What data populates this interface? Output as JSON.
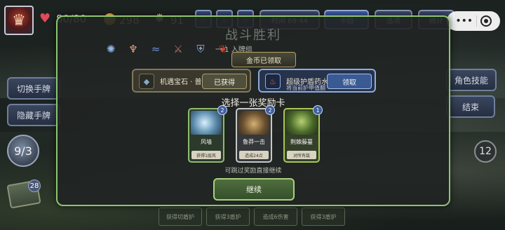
{
  "player": {
    "hp": "80/80",
    "gold": "298",
    "gems": "91"
  },
  "top_buttons": {
    "time": "时间 69:44",
    "deck": "卡组",
    "options": "选项",
    "stats": "统计"
  },
  "capsule": {
    "more": "•••"
  },
  "side": {
    "switch_hand": "切换手牌",
    "hide_hand": "隐藏手牌",
    "character_skill": "角色技能",
    "end_turn": "结束",
    "draw_pile": "9/3",
    "discard_count": "28",
    "turn": "12"
  },
  "hand_slots": [
    "获得切盾护",
    "获得3盾护",
    "造成6伤害",
    "获得3盾护"
  ],
  "modal": {
    "title": "战斗胜利",
    "join_text": "一 1 入牌组",
    "gold_claimed": "金币已领取",
    "rewards": [
      {
        "name": "机遇宝石 · 普",
        "button": "已获得"
      },
      {
        "name": "超级护盾药水",
        "desc": "将当前护甲值翻",
        "button": "领取"
      }
    ],
    "choose_title": "选择一张奖励卡",
    "cards": [
      {
        "name": "风墙",
        "desc": "获得1层风",
        "cost": "2"
      },
      {
        "name": "鲁莽一击",
        "desc": "造成24点",
        "cost": "2"
      },
      {
        "name": "荆棘藤蔓",
        "desc": "对所有敌",
        "cost": "1"
      }
    ],
    "skip_hint": "可跳过奖励直接继续",
    "continue": "继续"
  }
}
